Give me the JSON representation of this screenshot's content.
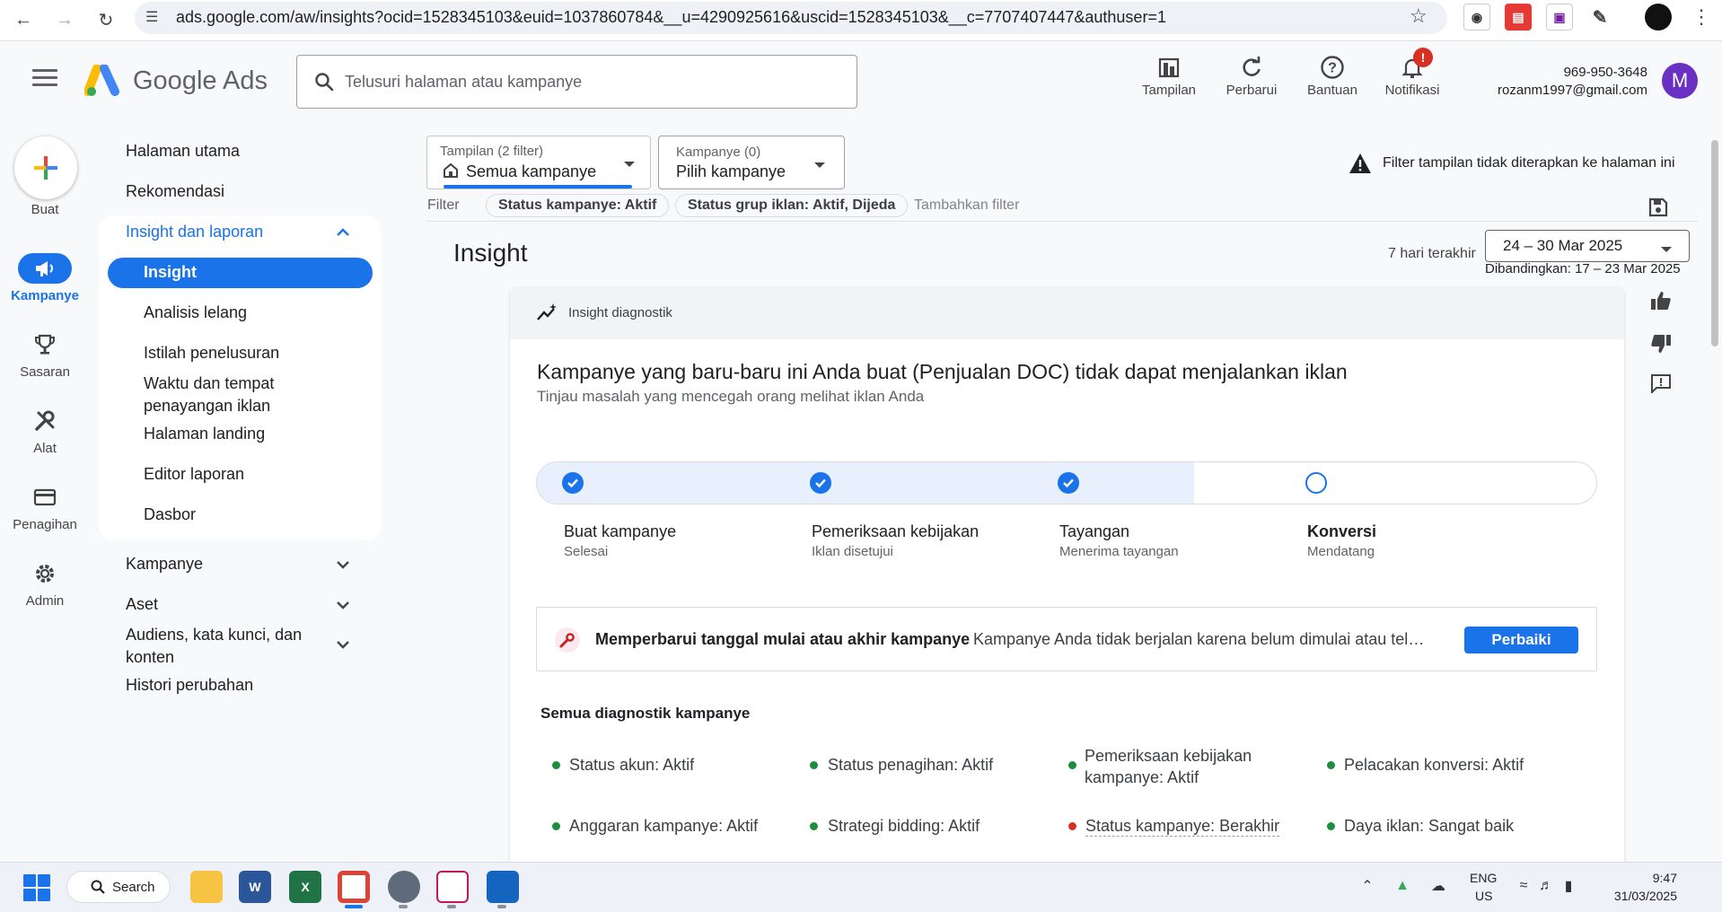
{
  "browser": {
    "url": "ads.google.com/aw/insights?ocid=1528345103&euid=1037860784&__u=4290925616&uscid=1528345103&__c=7707407447&authuser=1"
  },
  "header": {
    "logo_text": "Google Ads",
    "search_placeholder": "Telusuri halaman atau kampanye",
    "tools": [
      "Tampilan",
      "Perbarui",
      "Bantuan",
      "Notifikasi"
    ],
    "notification_badge": "!",
    "account_number": "969-950-3648",
    "account_email": "rozanm1997@gmail.com",
    "avatar_initial": "M"
  },
  "rail": {
    "create": "Buat",
    "items": [
      "Kampanye",
      "Sasaran",
      "Alat",
      "Penagihan",
      "Admin"
    ]
  },
  "sidenav": {
    "home": "Halaman utama",
    "recommendations": "Rekomendasi",
    "insights_parent": "Insight dan laporan",
    "insights_children": [
      "Insight",
      "Analisis lelang",
      "Istilah penelusuran",
      "Waktu dan tempat penayangan iklan",
      "Halaman landing",
      "Editor laporan",
      "Dasbor"
    ],
    "campaigns": "Kampanye",
    "assets": "Aset",
    "audiences": "Audiens, kata kunci, dan konten",
    "history": "Histori perubahan"
  },
  "filters": {
    "view_label": "Tampilan (2 filter)",
    "view_value": "Semua kampanye",
    "campaign_label": "Kampanye (0)",
    "campaign_value": "Pilih kampanye",
    "warning": "Filter tampilan tidak diterapkan ke halaman ini",
    "filter_label": "Filter",
    "chips": [
      "Status kampanye: Aktif",
      "Status grup iklan: Aktif, Dijeda"
    ],
    "add_filter": "Tambahkan filter"
  },
  "page": {
    "title": "Insight",
    "date_label": "7 hari terakhir",
    "date_range": "24 – 30 Mar 2025",
    "compare": "Dibandingkan: 17 – 23 Mar 2025"
  },
  "card": {
    "header": "Insight diagnostik",
    "headline": "Kampanye yang baru-baru ini Anda buat (Penjualan DOC) tidak dapat menjalankan iklan",
    "subhead": "Tinjau masalah yang mencegah orang melihat iklan Anda",
    "progress_fraction": 0.62,
    "steps": [
      {
        "title": "Buat kampanye",
        "sub": "Selesai",
        "done": true
      },
      {
        "title": "Pemeriksaan kebijakan",
        "sub": "Iklan disetujui",
        "done": true
      },
      {
        "title": "Tayangan",
        "sub": "Menerima tayangan",
        "done": true
      },
      {
        "title": "Konversi",
        "sub": "Mendatang",
        "done": false
      }
    ],
    "issue_title": "Memperbarui tanggal mulai atau akhir kampanye",
    "issue_desc": "Kampanye Anda tidak berjalan karena belum dimulai atau telah berakhir",
    "fix_button": "Perbaiki",
    "all_diagnostics_heading": "Semua diagnostik kampanye",
    "diagnostics": [
      {
        "text": "Status akun: Aktif",
        "status": "ok"
      },
      {
        "text": "Status penagihan: Aktif",
        "status": "ok"
      },
      {
        "text": "Pemeriksaan kebijakan kampanye: Aktif",
        "status": "ok"
      },
      {
        "text": "Pelacakan konversi: Aktif",
        "status": "ok"
      },
      {
        "text": "Anggaran kampanye: Aktif",
        "status": "ok"
      },
      {
        "text": "Strategi bidding: Aktif",
        "status": "ok"
      },
      {
        "text": "Status kampanye: Berakhir",
        "status": "bad"
      },
      {
        "text": "Daya iklan: Sangat baik",
        "status": "ok"
      }
    ]
  },
  "taskbar": {
    "search": "Search",
    "lang1": "ENG",
    "lang2": "US",
    "time": "9:47",
    "date": "31/03/2025"
  },
  "colors": {
    "accent": "#1a73e8",
    "ok": "#1e8e3e",
    "error": "#d93025"
  }
}
